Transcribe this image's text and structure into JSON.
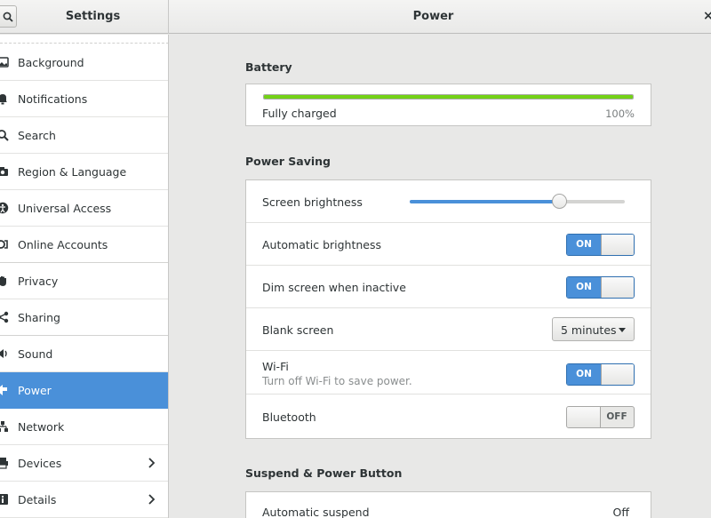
{
  "header": {
    "sidebar_title": "Settings",
    "page_title": "Power",
    "close_glyph": "×"
  },
  "sidebar": {
    "items": [
      {
        "label": "Background",
        "icon": "background-icon"
      },
      {
        "label": "Notifications",
        "icon": "bell-icon"
      },
      {
        "label": "Search",
        "icon": "search-icon"
      },
      {
        "label": "Region & Language",
        "icon": "camera-icon"
      },
      {
        "label": "Universal Access",
        "icon": "accessibility-icon"
      },
      {
        "label": "Online Accounts",
        "icon": "online-accounts-icon"
      },
      {
        "label": "Privacy",
        "icon": "hand-icon"
      },
      {
        "label": "Sharing",
        "icon": "share-icon"
      },
      {
        "label": "Sound",
        "icon": "speaker-icon"
      },
      {
        "label": "Power",
        "icon": "power-icon",
        "active": true
      },
      {
        "label": "Network",
        "icon": "network-icon"
      },
      {
        "label": "Devices",
        "icon": "printer-icon",
        "chevron": true
      },
      {
        "label": "Details",
        "icon": "info-icon",
        "chevron": true
      }
    ]
  },
  "battery": {
    "title": "Battery",
    "status": "Fully charged",
    "percent_text": "100%",
    "level": 1.0
  },
  "power_saving": {
    "title": "Power Saving",
    "screen_brightness": {
      "label": "Screen brightness",
      "level": 0.7
    },
    "automatic_brightness": {
      "label": "Automatic brightness",
      "state": "ON"
    },
    "dim_screen": {
      "label": "Dim screen when inactive",
      "state": "ON"
    },
    "blank_screen": {
      "label": "Blank screen",
      "value": "5 minutes"
    },
    "wifi": {
      "label": "Wi-Fi",
      "sublabel": "Turn off Wi-Fi to save power.",
      "state": "ON"
    },
    "bluetooth": {
      "label": "Bluetooth",
      "state": "OFF"
    }
  },
  "suspend": {
    "title": "Suspend & Power Button",
    "automatic_suspend": {
      "label": "Automatic suspend",
      "value": "Off"
    }
  },
  "colors": {
    "accent": "#4a90d9",
    "battery_fill": "#73d216"
  }
}
